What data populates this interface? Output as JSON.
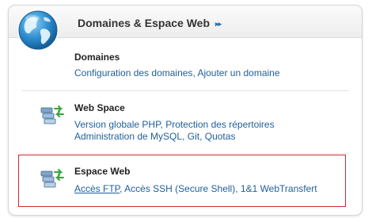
{
  "header": {
    "title": "Domaines & Espace Web",
    "title_arrows": "▸▸",
    "icon": "globe-icon"
  },
  "sections": [
    {
      "title": "Domaines",
      "icon": null,
      "links": [
        {
          "label": "Configuration des domaines"
        },
        {
          "label": "Ajouter un domaine"
        }
      ]
    },
    {
      "title": "Web Space",
      "icon": "network-sync-icon",
      "links": [
        {
          "label": "Version globale PHP"
        },
        {
          "label": "Protection des répertoires"
        },
        {
          "label": "Administration de MySQL"
        },
        {
          "label": "Git"
        },
        {
          "label": "Quotas"
        }
      ]
    },
    {
      "title": "Espace Web",
      "icon": "network-sync-icon",
      "highlighted": true,
      "links": [
        {
          "label": "Accès FTP",
          "hovered": true
        },
        {
          "label": "Accès SSH (Secure Shell)"
        },
        {
          "label": "1&1 WebTransfert"
        }
      ]
    }
  ],
  "separator": ", ",
  "colors": {
    "link": "#1f5f99",
    "highlight_border": "#cc2b2b",
    "title": "#333333"
  }
}
